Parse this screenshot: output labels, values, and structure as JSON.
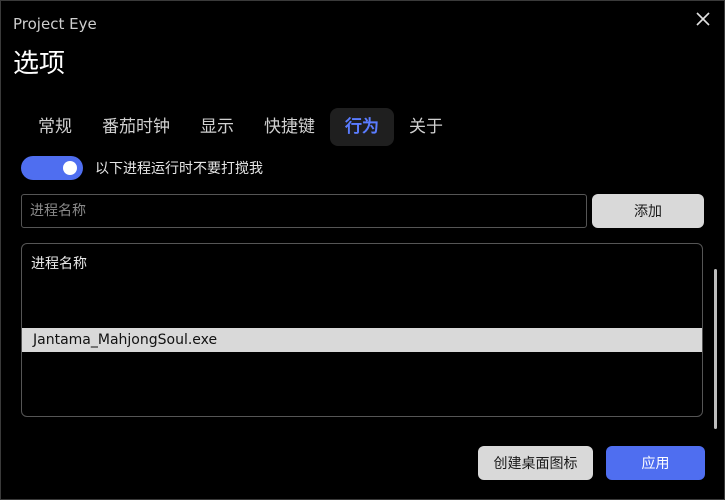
{
  "window": {
    "app_title": "Project Eye",
    "page_title": "选项",
    "close_icon": "close-icon"
  },
  "tabs": [
    {
      "label": "常规",
      "active": false
    },
    {
      "label": "番茄时钟",
      "active": false
    },
    {
      "label": "显示",
      "active": false
    },
    {
      "label": "快捷键",
      "active": false
    },
    {
      "label": "行为",
      "active": true
    },
    {
      "label": "关于",
      "active": false
    }
  ],
  "behavior": {
    "dnd_toggle": {
      "on": true,
      "label": "以下进程运行时不要打搅我"
    },
    "process_input": {
      "value": "",
      "placeholder": "进程名称"
    },
    "add_label": "添加",
    "list": {
      "header": "进程名称",
      "items": [
        "Jantama_MahjongSoul.exe"
      ],
      "selected_index": 0
    }
  },
  "footer": {
    "create_desktop_icon_label": "创建桌面图标",
    "apply_label": "应用"
  },
  "colors": {
    "accent": "#4f6ef0",
    "active_tab_text": "#5a7cff",
    "background": "#000000"
  }
}
